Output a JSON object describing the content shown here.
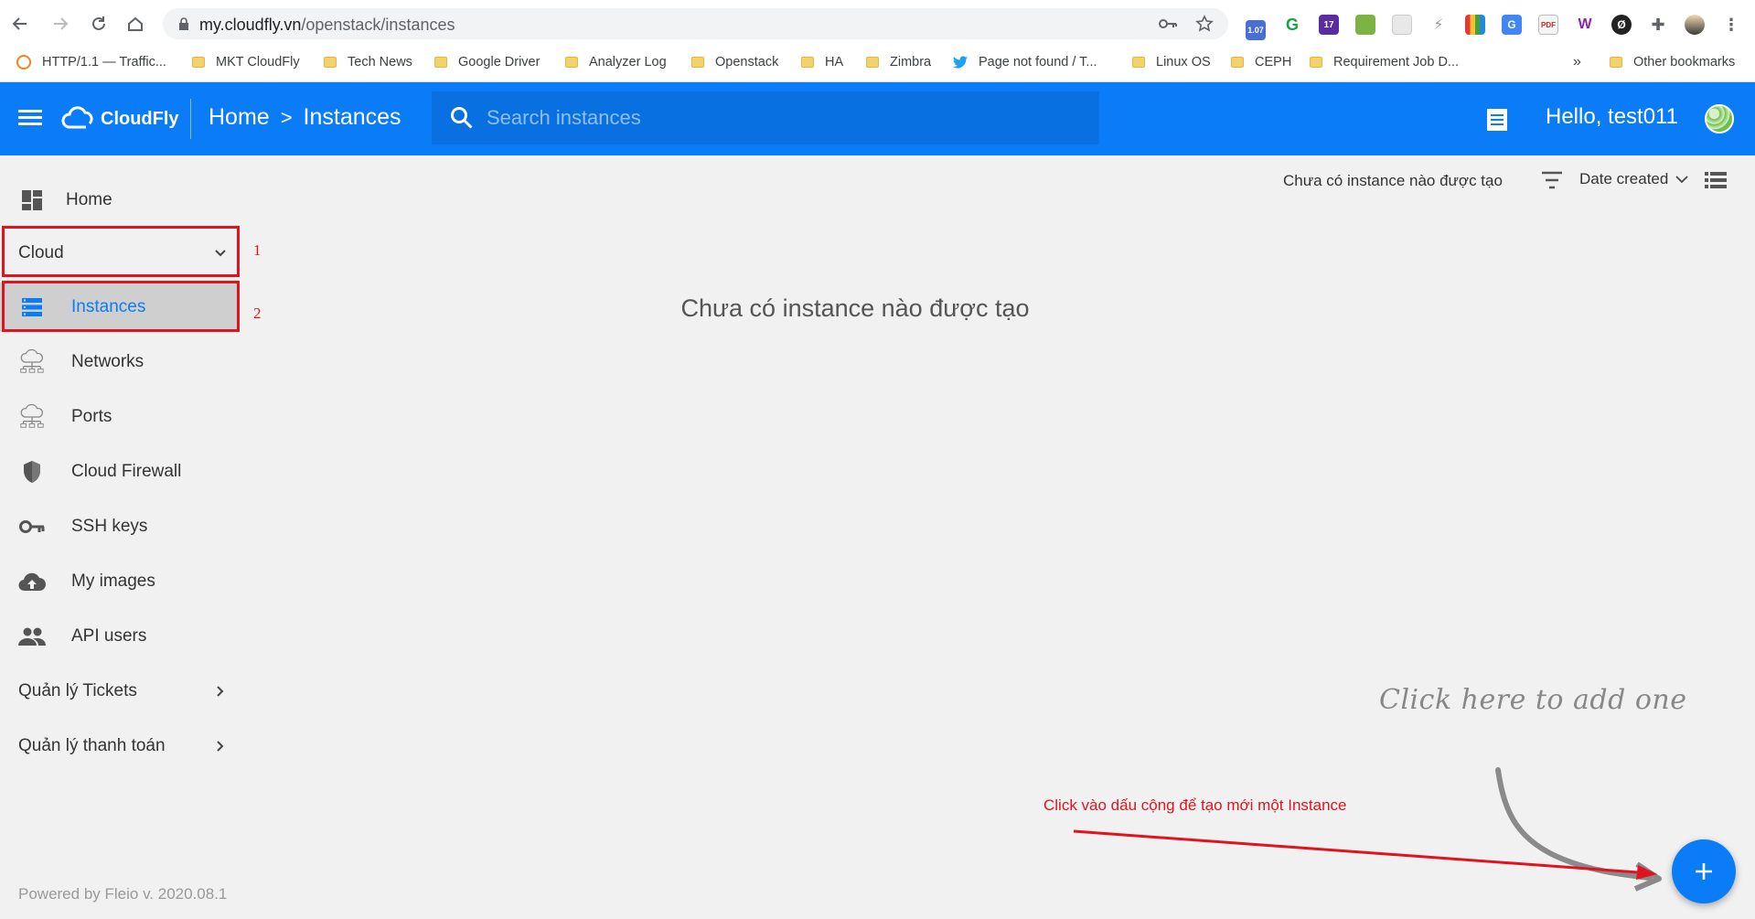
{
  "browser": {
    "url_host": "my.cloudfly.vn",
    "url_path": "/openstack/instances",
    "extensions": {
      "badge_1": "1.07",
      "badge_2": "17"
    },
    "bookmarks": [
      {
        "label": "HTTP/1.1 — Traffic...",
        "icon": "cloudflare-icon"
      },
      {
        "label": "MKT CloudFly",
        "icon": "folder-icon"
      },
      {
        "label": "Tech News",
        "icon": "folder-icon"
      },
      {
        "label": "Google Driver",
        "icon": "folder-icon"
      },
      {
        "label": "Analyzer Log",
        "icon": "folder-icon"
      },
      {
        "label": "Openstack",
        "icon": "folder-icon"
      },
      {
        "label": "HA",
        "icon": "folder-icon"
      },
      {
        "label": "Zimbra",
        "icon": "folder-icon"
      },
      {
        "label": "Page not found / T...",
        "icon": "twitter-icon"
      },
      {
        "label": "Linux OS",
        "icon": "folder-icon"
      },
      {
        "label": "CEPH",
        "icon": "folder-icon"
      },
      {
        "label": "Requirement Job D...",
        "icon": "folder-icon"
      }
    ],
    "overflow_label": "»",
    "other_bookmarks": "Other bookmarks"
  },
  "header": {
    "brand": "CloudFly",
    "breadcrumb_home": "Home",
    "breadcrumb_sep": ">",
    "breadcrumb_current": "Instances",
    "search_placeholder": "Search instances",
    "greeting": "Hello, test011",
    "accent_color": "#0a7cf7"
  },
  "sidebar": {
    "home": "Home",
    "cloud": "Cloud",
    "items": [
      {
        "label": "Instances",
        "icon": "server-list-icon"
      },
      {
        "label": "Networks",
        "icon": "network-cloud-icon"
      },
      {
        "label": "Ports",
        "icon": "network-cloud-icon"
      },
      {
        "label": "Cloud Firewall",
        "icon": "shield-icon"
      },
      {
        "label": "SSH keys",
        "icon": "key-icon"
      },
      {
        "label": "My images",
        "icon": "cloud-upload-icon"
      },
      {
        "label": "API users",
        "icon": "users-icon"
      }
    ],
    "tickets": "Quản lý Tickets",
    "billing": "Quản lý thanh toán",
    "powered_by": "Powered by Fleio v. 2020.08.1"
  },
  "annotations": {
    "box_1_number": "1",
    "box_2_number": "2",
    "hint": "Click here to add one",
    "instruction": "Click vào dấu cộng để tạo mới một Instance",
    "highlight_color": "#e0141e"
  },
  "main": {
    "status": "Chưa có instance nào được tạo",
    "sort_label": "Date created",
    "empty_message": "Chưa có instance nào được tạo",
    "add_label": "+"
  }
}
